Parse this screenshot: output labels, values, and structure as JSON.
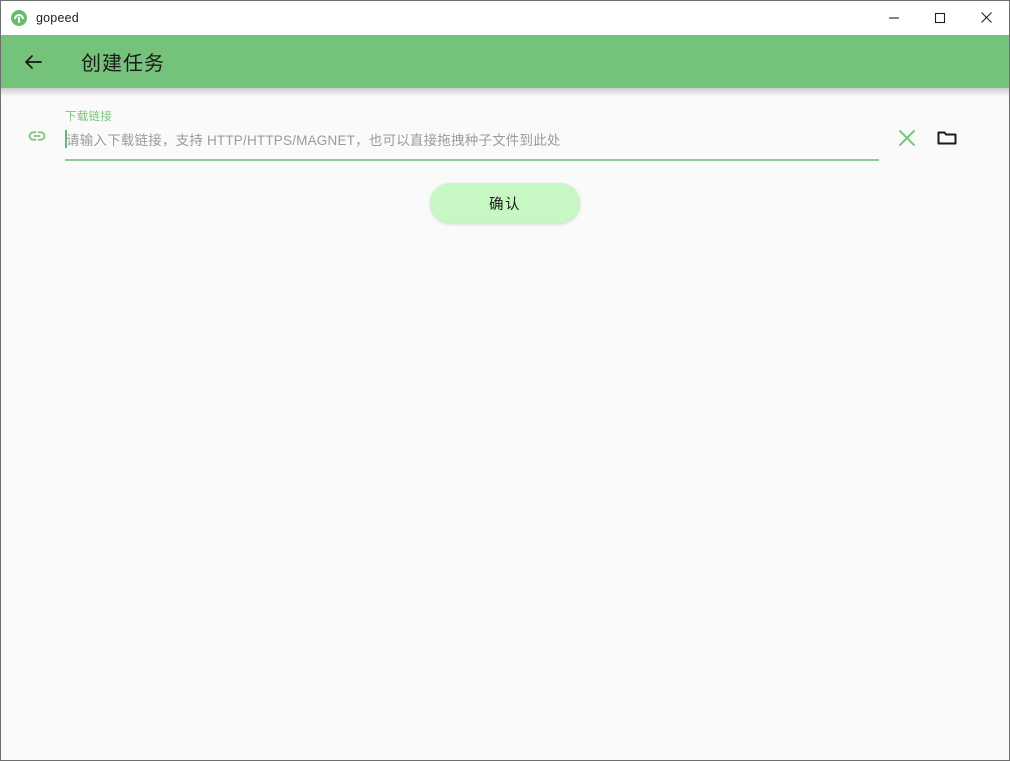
{
  "window": {
    "app_title": "gopeed",
    "app_icon": "gopeed-logo-icon",
    "controls": {
      "minimize": "minimize-icon",
      "maximize": "maximize-icon",
      "close": "close-icon"
    }
  },
  "appbar": {
    "back_icon": "arrow-left-icon",
    "title": "创建任务",
    "background_color": "#75c37a"
  },
  "form": {
    "leading_icon": "link-icon",
    "field": {
      "label": "下载链接",
      "value": "",
      "placeholder": "请输入下载链接，支持 HTTP/HTTPS/MAGNET，也可以直接拖拽种子文件到此处",
      "label_color": "#7cc47f",
      "underline_color": "#8ecb92",
      "caret_color": "#5fbb67"
    },
    "actions": {
      "clear_icon": "close-x-icon",
      "folder_icon": "folder-icon"
    },
    "submit": {
      "label": "确认",
      "background_color": "#c7f7c2"
    }
  }
}
